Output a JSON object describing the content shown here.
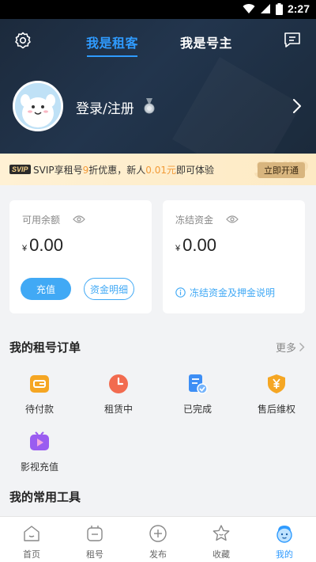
{
  "status_bar": {
    "time": "2:27"
  },
  "header": {
    "tabs": [
      {
        "label": "我是租客",
        "active": true
      },
      {
        "label": "我是号主",
        "active": false
      }
    ],
    "login_label": "登录/注册"
  },
  "promo": {
    "badge": "SVIP",
    "text_prefix": "SVIP享租号",
    "text_discount": "9",
    "text_mid": "折优惠，新人",
    "text_price": "0.01元",
    "text_suffix": "即可体验",
    "button": "立即开通",
    "watermark": "SVIP"
  },
  "balance": {
    "available_label": "可用余额",
    "available_amount": "0.00",
    "currency": "¥",
    "recharge_button": "充值",
    "detail_button": "资金明细",
    "frozen_label": "冻结资金",
    "frozen_amount": "0.00",
    "frozen_link": "冻结资金及押金说明"
  },
  "orders": {
    "title": "我的租号订单",
    "more": "更多",
    "items": [
      {
        "label": "待付款",
        "icon": "wallet-icon",
        "color": "#f5a623"
      },
      {
        "label": "租赁中",
        "icon": "clock-icon",
        "color": "#f26b4f"
      },
      {
        "label": "已完成",
        "icon": "document-check-icon",
        "color": "#3d8ef5"
      },
      {
        "label": "售后维权",
        "icon": "shield-yen-icon",
        "color": "#f5a623"
      },
      {
        "label": "影视充值",
        "icon": "tv-play-icon",
        "color": "#9a5cf0"
      }
    ]
  },
  "tools": {
    "title": "我的常用工具"
  },
  "bottom_nav": [
    {
      "label": "首页",
      "icon": "home-icon",
      "active": false
    },
    {
      "label": "租号",
      "icon": "gamepad-icon",
      "active": false
    },
    {
      "label": "发布",
      "icon": "plus-circle-icon",
      "active": false
    },
    {
      "label": "收藏",
      "icon": "star-icon",
      "active": false
    },
    {
      "label": "我的",
      "icon": "profile-icon",
      "active": true
    }
  ],
  "colors": {
    "accent": "#2f9bff",
    "button_blue": "#41a9f5",
    "header_bg": "#1c2a3c"
  }
}
